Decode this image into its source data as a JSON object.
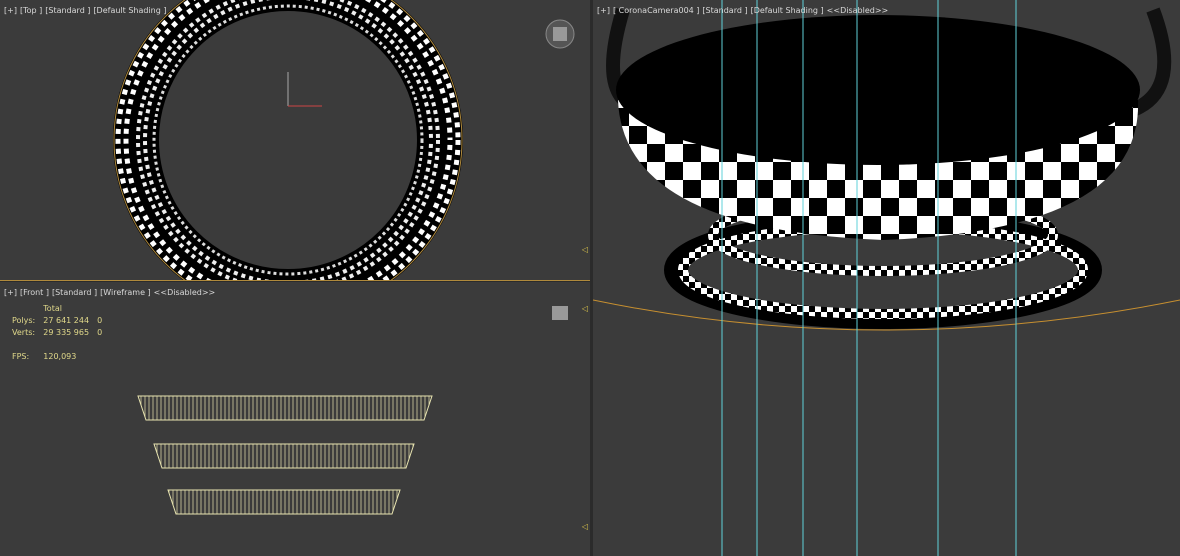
{
  "viewports": {
    "top": {
      "labels": [
        "[+]",
        "[Top ]",
        "[Standard ]",
        "[Default Shading ]"
      ]
    },
    "front": {
      "labels": [
        "[+]",
        "[Front ]",
        "[Standard ]",
        "[Wireframe ]",
        "<<Disabled>>"
      ]
    },
    "camera": {
      "labels": [
        "[+]",
        "[ CoronaCamera004 ]",
        "[Standard ]",
        "[Default Shading ]",
        "<<Disabled>>"
      ]
    }
  },
  "stats": {
    "header": "Total",
    "polys_label": "Polys:",
    "polys_value": "27 641 244",
    "polys_sel": "0",
    "verts_label": "Verts:",
    "verts_value": "29 335 965",
    "verts_sel": "0",
    "fps_label": "FPS:",
    "fps_value": "120,093"
  },
  "colors": {
    "background": "#3b3b3b",
    "selection": "#d9a040",
    "guide": "#5fd0d8",
    "wire": "#e8e4b0",
    "text": "#d8d8d8",
    "stats": "#e0d88a"
  }
}
